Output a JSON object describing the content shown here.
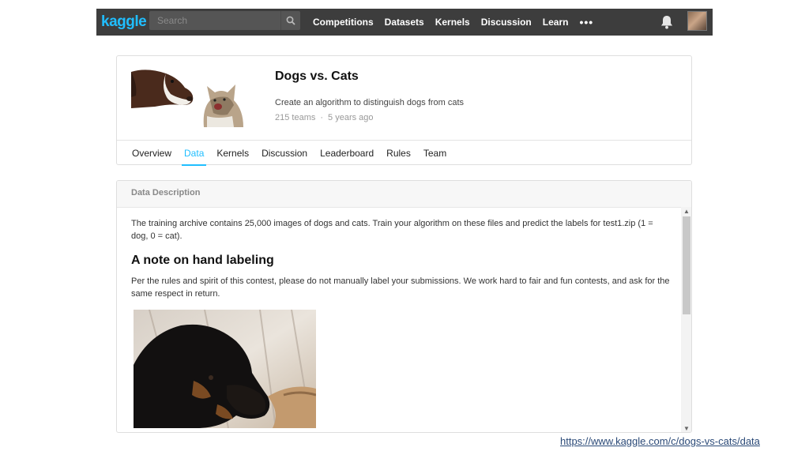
{
  "nav": {
    "logo": "kaggle",
    "search_placeholder": "Search",
    "links": [
      "Competitions",
      "Datasets",
      "Kernels",
      "Discussion",
      "Learn"
    ],
    "more": "•••",
    "icons": {
      "search": "search-icon",
      "bell": "bell-icon",
      "more": "more-icon"
    }
  },
  "competition": {
    "title": "Dogs vs. Cats",
    "subtitle": "Create an algorithm to distinguish dogs from cats",
    "teams": "215 teams",
    "age": "5 years ago",
    "tabs": [
      "Overview",
      "Data",
      "Kernels",
      "Discussion",
      "Leaderboard",
      "Rules",
      "Team"
    ],
    "active_tab": "Data"
  },
  "data_section": {
    "header": "Data Description",
    "para1": "The training archive contains 25,000 images of dogs and cats. Train your algorithm on these files and predict the labels for test1.zip (1 = dog, 0 = cat).",
    "heading": "A note on hand labeling",
    "para2": "Per the rules and spirit of this contest, please do not manually label your submissions. We work hard to fair and fun contests, and ask for the same respect in return."
  },
  "footer": {
    "url": "https://www.kaggle.com/c/dogs-vs-cats/data"
  },
  "colors": {
    "accent": "#20beff",
    "topbar": "#3d3d3d"
  }
}
